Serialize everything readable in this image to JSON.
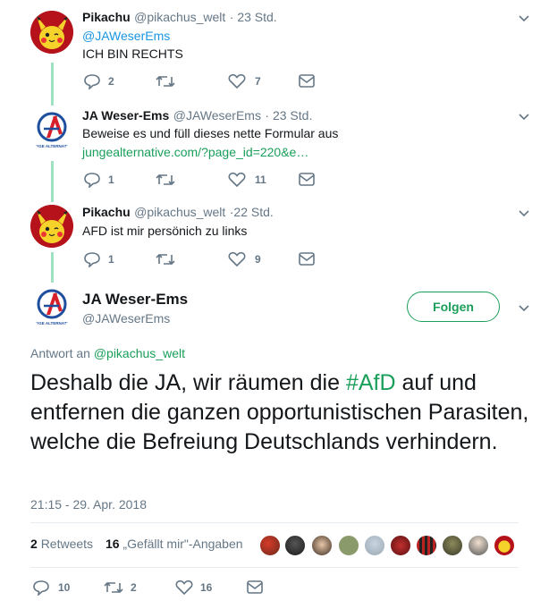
{
  "tweet1": {
    "name": "Pikachu",
    "handle": "@pikachus_welt",
    "time": "· 23 Std.",
    "mention": "@JAWeserEms",
    "text": "ICH BIN RECHTS",
    "replies": "2",
    "retweets": "",
    "likes": "7"
  },
  "tweet2": {
    "name": "JA Weser-Ems",
    "handle": "@JAWeserEms",
    "time": "· 23 Std.",
    "text": "Beweise es und füll dieses nette Formular aus",
    "link": "jungealternative.com/?page_id=220&e…",
    "replies": "1",
    "retweets": "",
    "likes": "11"
  },
  "tweet3": {
    "name": "Pikachu",
    "handle": "@pikachus_welt",
    "time": "·22 Std.",
    "text": "AFD ist mir persönich zu links",
    "replies": "1",
    "retweets": "",
    "likes": "9"
  },
  "main": {
    "name": "JA Weser-Ems",
    "handle": "@JAWeserEms",
    "follow_label": "Folgen",
    "reply_prefix": "Antwort an",
    "reply_to": "@pikachus_welt",
    "text_before": "Deshalb die JA, wir räumen die ",
    "hashtag": "#AfD",
    "text_after": " auf und entfernen die ganzen opportunistischen Parasiten, welche die Befreiung Deutschlands verhindern.",
    "timestamp": "21:15 - 29. Apr. 2018",
    "retweet_count": "2",
    "retweet_label": "Retweets",
    "like_count": "16",
    "like_label": "„Gefällt mir\"-Angaben",
    "replies": "10",
    "retweets": "2",
    "likes": "16"
  },
  "logo": {
    "caption": "JUNGE ALTERNATIVE"
  },
  "colors": {
    "accent": "#1a9f5a",
    "link": "#1b95e0",
    "thread": "#9fe0c0",
    "muted": "#657786"
  }
}
